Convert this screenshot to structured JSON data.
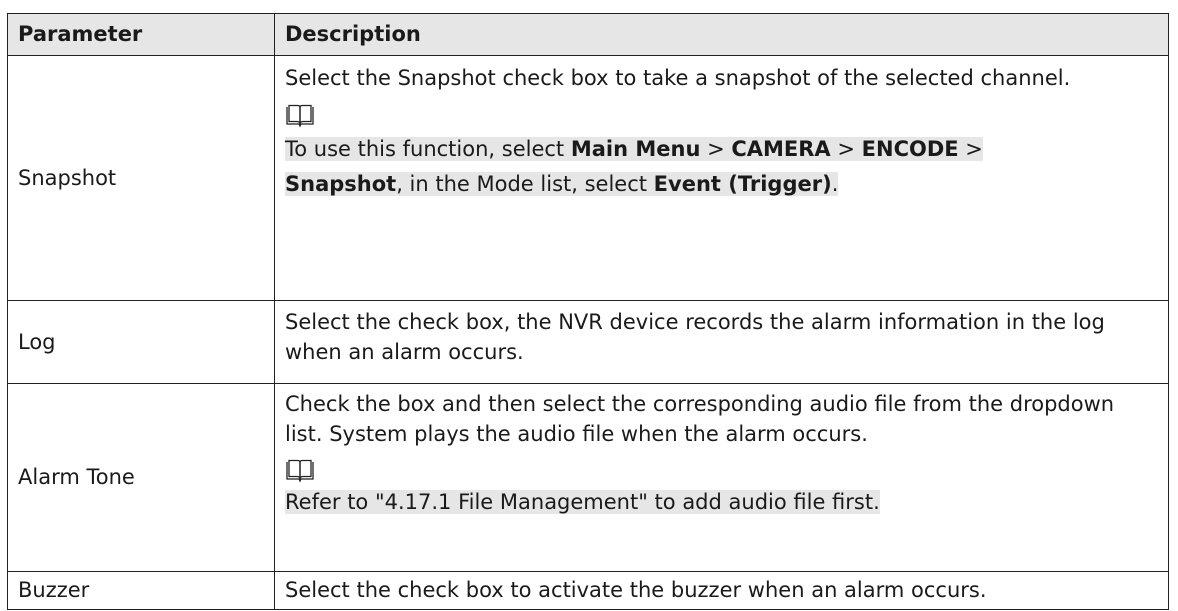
{
  "header": {
    "parameter": "Parameter",
    "description": "Description"
  },
  "rows": {
    "snapshot": {
      "parameter": "Snapshot",
      "text": "Select the Snapshot check box to take a snapshot of the selected channel.",
      "note": {
        "icon": "book-note-icon",
        "t1": "To use this function, select ",
        "b1": "Main Menu",
        "t2": " > ",
        "b2": "CAMERA",
        "t3": " > ",
        "b3": "ENCODE",
        "t4": " >",
        "b4": "Snapshot",
        "t5": ", in the Mode list, select ",
        "b5": "Event (Trigger)",
        "t6": "."
      }
    },
    "log": {
      "parameter": "Log",
      "text": "Select the check box, the NVR device records the alarm information in the log when an alarm occurs."
    },
    "alarm_tone": {
      "parameter": "Alarm Tone",
      "text": "Check the box and then select the corresponding audio file from the dropdown list. System plays the audio file when the alarm occurs.",
      "note": {
        "icon": "book-note-icon",
        "text": "Refer to \"4.17.1 File Management\" to add audio file first."
      }
    },
    "buzzer": {
      "parameter": "Buzzer",
      "text": "Select the check box to activate the buzzer when an alarm occurs."
    }
  },
  "colors": {
    "header_bg": "#e6e6e6",
    "highlight": "#e6e6e6",
    "border": "#222222"
  }
}
